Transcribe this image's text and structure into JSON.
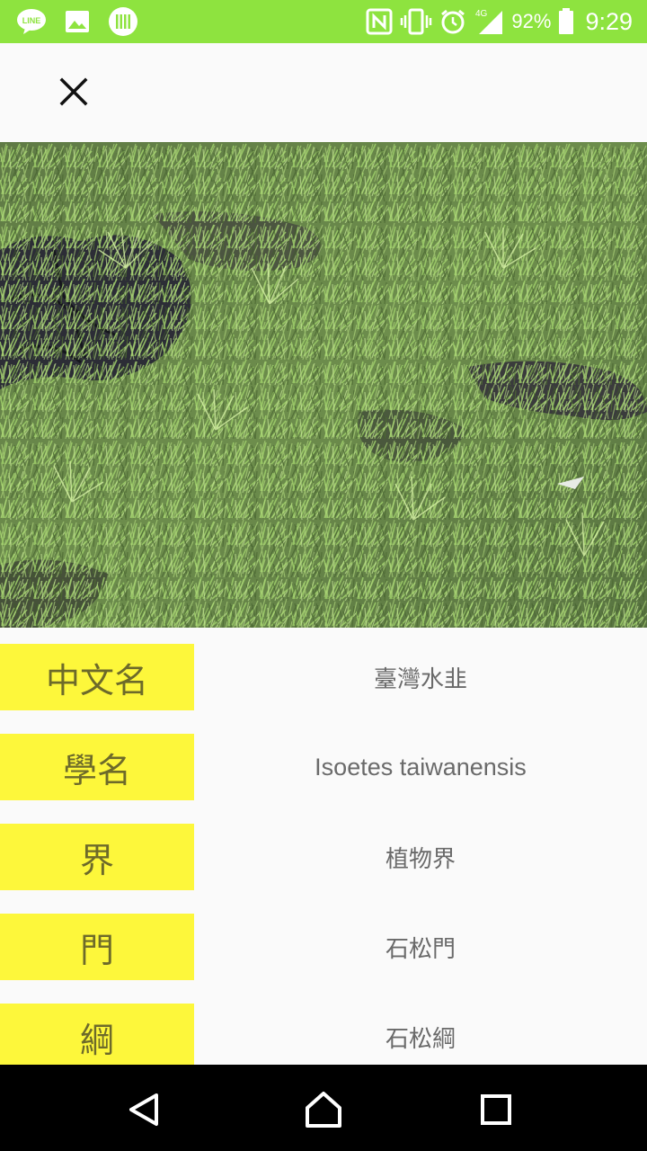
{
  "status_bar": {
    "background": "#8ee33f",
    "left_icons": [
      "line-app-icon",
      "gallery-icon",
      "barcode-icon"
    ],
    "right_icons": [
      "nfc-icon",
      "vibrate-icon",
      "alarm-icon",
      "signal-4g-icon",
      "battery-icon"
    ],
    "network": "4G",
    "battery_percent": "92%",
    "time": "9:29"
  },
  "toolbar": {
    "close_icon": "close-icon"
  },
  "photo": {
    "subject": "grass-field-photo"
  },
  "info_rows": [
    {
      "label": "中文名",
      "value": "臺灣水韭"
    },
    {
      "label": "學名",
      "value": "Isoetes taiwanensis"
    },
    {
      "label": "界",
      "value": "植物界"
    },
    {
      "label": "門",
      "value": "石松門"
    },
    {
      "label": "綱",
      "value": "石松綱"
    }
  ],
  "colors": {
    "label_background": "#fdf73b",
    "label_text": "#6d6a2a",
    "value_text": "#6a6a6a",
    "page_background": "#fafafa"
  },
  "nav_bar": {
    "buttons": [
      "back-icon",
      "home-icon",
      "recents-icon"
    ]
  }
}
